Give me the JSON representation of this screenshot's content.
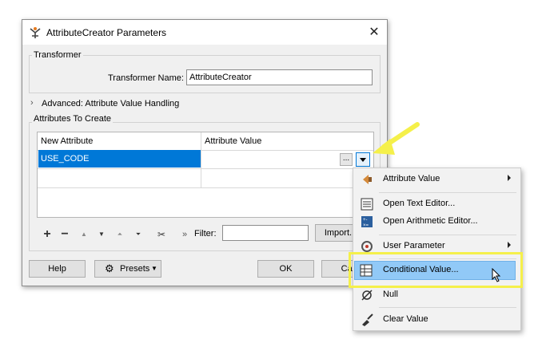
{
  "dialog": {
    "title": "AttributeCreator Parameters",
    "close_glyph": "✕",
    "transformer_group_label": "Transformer",
    "transformer_name_label": "Transformer Name:",
    "transformer_name_value": "AttributeCreator",
    "advanced_label": "Advanced: Attribute Value Handling",
    "attributes_group_label": "Attributes To Create",
    "table": {
      "headers": [
        "New Attribute",
        "Attribute Value"
      ],
      "rows": [
        [
          "USE_CODE",
          ""
        ]
      ]
    },
    "ellipsis_label": "...",
    "filter_label": "Filter:",
    "filter_value": "",
    "import_label": "Import...",
    "help_label": "Help",
    "presets_label": "Presets",
    "ok_label": "OK",
    "cancel_label": "Canc"
  },
  "toolbar_icons": [
    "add-icon",
    "remove-icon",
    "move-up-icon",
    "move-down-icon",
    "move-top-icon",
    "move-bottom-icon",
    "cut-icon",
    "expand-icon"
  ],
  "menu": {
    "items": [
      {
        "label": "Attribute Value",
        "icon": "attribute-value-icon",
        "submenu": true
      },
      {
        "label": "Open Text Editor...",
        "icon": "text-editor-icon",
        "submenu": false
      },
      {
        "label": "Open Arithmetic Editor...",
        "icon": "arithmetic-editor-icon",
        "submenu": false
      },
      {
        "label": "User Parameter",
        "icon": "user-parameter-icon",
        "submenu": true
      },
      {
        "label": "Conditional Value...",
        "icon": "conditional-value-icon",
        "submenu": false
      },
      {
        "label": "Null",
        "icon": "null-icon",
        "submenu": false
      },
      {
        "label": "Clear Value",
        "icon": "clear-value-icon",
        "submenu": false
      }
    ]
  },
  "colors": {
    "selection": "#0078d7",
    "menu_highlight": "#91c9f7",
    "callout_yellow": "#f5f04a"
  }
}
